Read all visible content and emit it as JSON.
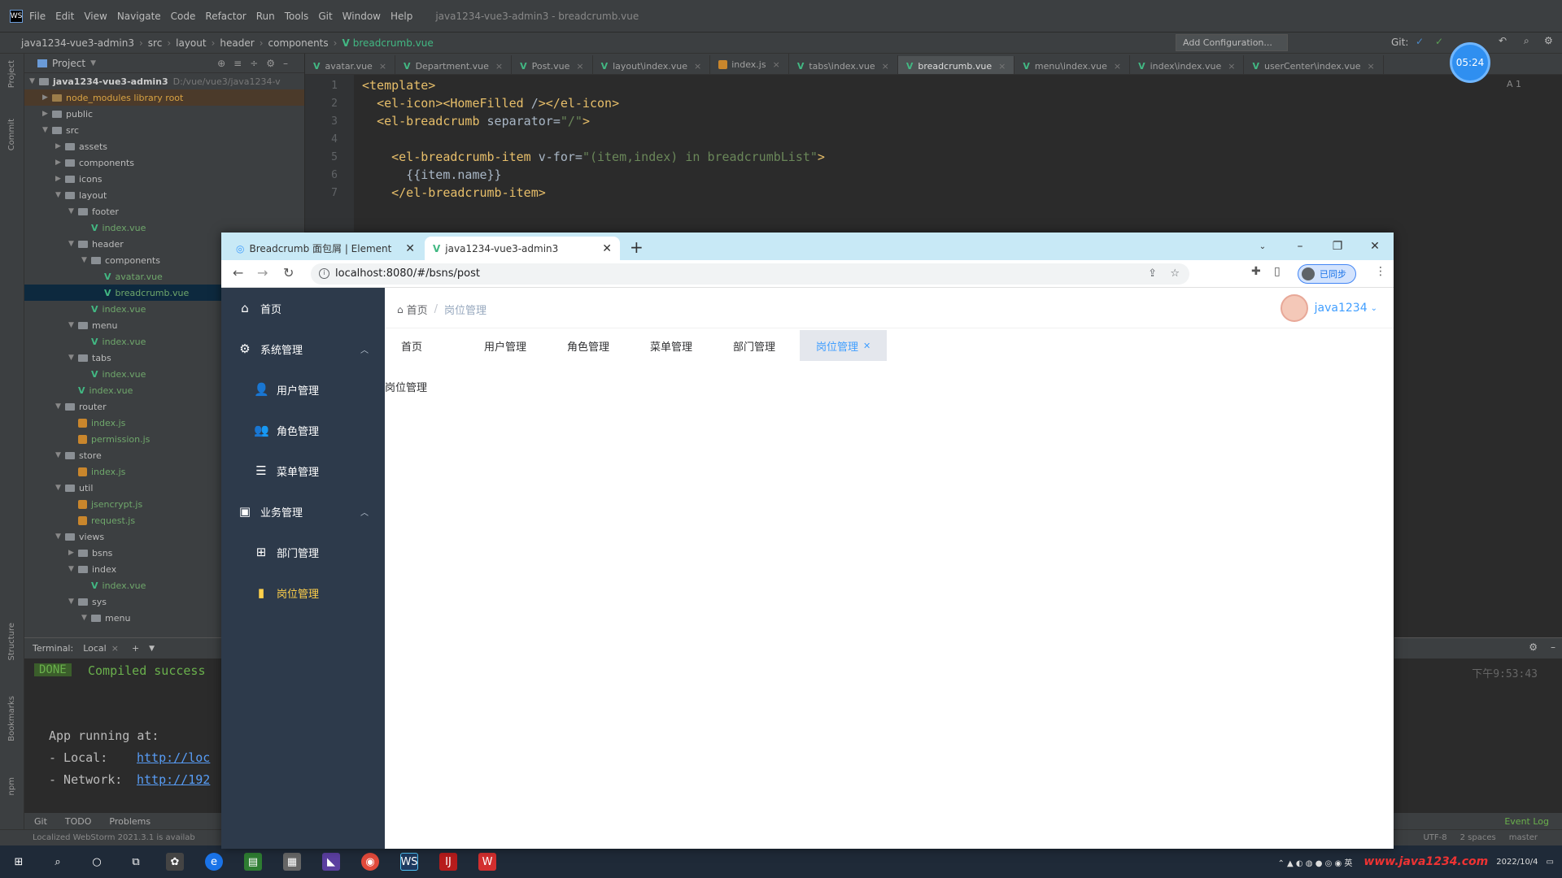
{
  "ide": {
    "menu": [
      "File",
      "Edit",
      "View",
      "Navigate",
      "Code",
      "Refactor",
      "Run",
      "Tools",
      "Git",
      "Window",
      "Help"
    ],
    "window_title": "java1234-vue3-admin3 - breadcrumb.vue",
    "path": [
      "java1234-vue3-admin3",
      "src",
      "layout",
      "header",
      "components"
    ],
    "path_file": "breadcrumb.vue",
    "add_config": "Add Configuration...",
    "git_label": "Git:",
    "side_strip": [
      "Project",
      "Commit",
      "Structure",
      "Bookmarks",
      "npm"
    ],
    "project": {
      "title": "Project",
      "root": "java1234-vue3-admin3",
      "root_path": "D:/vue/vue3/java1234-v",
      "node_modules": "node_modules  library root",
      "items": [
        {
          "label": "public",
          "type": "folder",
          "depth": 1,
          "open": false
        },
        {
          "label": "src",
          "type": "folder",
          "depth": 1,
          "open": true
        },
        {
          "label": "assets",
          "type": "folder",
          "depth": 2,
          "open": false
        },
        {
          "label": "components",
          "type": "folder",
          "depth": 2,
          "open": false
        },
        {
          "label": "icons",
          "type": "folder",
          "depth": 2,
          "open": false
        },
        {
          "label": "layout",
          "type": "folder",
          "depth": 2,
          "open": true
        },
        {
          "label": "footer",
          "type": "folder",
          "depth": 3,
          "open": true
        },
        {
          "label": "index.vue",
          "type": "vue",
          "depth": 4
        },
        {
          "label": "header",
          "type": "folder",
          "depth": 3,
          "open": true
        },
        {
          "label": "components",
          "type": "folder",
          "depth": 4,
          "open": true
        },
        {
          "label": "avatar.vue",
          "type": "vue",
          "depth": 5
        },
        {
          "label": "breadcrumb.vue",
          "type": "vue",
          "depth": 5,
          "selected": true
        },
        {
          "label": "index.vue",
          "type": "vue",
          "depth": 4
        },
        {
          "label": "menu",
          "type": "folder",
          "depth": 3,
          "open": true
        },
        {
          "label": "index.vue",
          "type": "vue",
          "depth": 4
        },
        {
          "label": "tabs",
          "type": "folder",
          "depth": 3,
          "open": true
        },
        {
          "label": "index.vue",
          "type": "vue",
          "depth": 4
        },
        {
          "label": "index.vue",
          "type": "vue",
          "depth": 3
        },
        {
          "label": "router",
          "type": "folder",
          "depth": 2,
          "open": true
        },
        {
          "label": "index.js",
          "type": "js",
          "depth": 3
        },
        {
          "label": "permission.js",
          "type": "js",
          "depth": 3
        },
        {
          "label": "store",
          "type": "folder",
          "depth": 2,
          "open": true
        },
        {
          "label": "index.js",
          "type": "js",
          "depth": 3
        },
        {
          "label": "util",
          "type": "folder",
          "depth": 2,
          "open": true
        },
        {
          "label": "jsencrypt.js",
          "type": "js",
          "depth": 3
        },
        {
          "label": "request.js",
          "type": "js",
          "depth": 3
        },
        {
          "label": "views",
          "type": "folder",
          "depth": 2,
          "open": true
        },
        {
          "label": "bsns",
          "type": "folder",
          "depth": 3,
          "open": false
        },
        {
          "label": "index",
          "type": "folder",
          "depth": 3,
          "open": true
        },
        {
          "label": "index.vue",
          "type": "vue",
          "depth": 4
        },
        {
          "label": "sys",
          "type": "folder",
          "depth": 3,
          "open": true
        },
        {
          "label": "menu",
          "type": "folder",
          "depth": 4,
          "open": true
        }
      ]
    },
    "editor_tabs": [
      {
        "label": "avatar.vue",
        "kind": "vue"
      },
      {
        "label": "Department.vue",
        "kind": "vue"
      },
      {
        "label": "Post.vue",
        "kind": "vue"
      },
      {
        "label": "layout\\index.vue",
        "kind": "vue"
      },
      {
        "label": "index.js",
        "kind": "js"
      },
      {
        "label": "tabs\\index.vue",
        "kind": "vue"
      },
      {
        "label": "breadcrumb.vue",
        "kind": "vue",
        "active": true
      },
      {
        "label": "menu\\index.vue",
        "kind": "vue"
      },
      {
        "label": "index\\index.vue",
        "kind": "vue"
      },
      {
        "label": "userCenter\\index.vue",
        "kind": "vue"
      }
    ],
    "code_lines": [
      {
        "n": "1",
        "t": "<template>"
      },
      {
        "n": "2",
        "t": "  <el-icon><HomeFilled /></el-icon>"
      },
      {
        "n": "3",
        "t": "  <el-breadcrumb separator=\"/\">"
      },
      {
        "n": "4",
        "t": ""
      },
      {
        "n": "5",
        "t": "    <el-breadcrumb-item v-for=\"(item,index) in breadcrumbList\">"
      },
      {
        "n": "6",
        "t": "      {{item.name}}"
      },
      {
        "n": "7",
        "t": "    </el-breadcrumb-item>"
      }
    ],
    "warning_badge": "A 1",
    "recording_timer": "05:24",
    "terminal": {
      "tabs": [
        "Terminal:",
        "Local"
      ],
      "done": "DONE",
      "compiled": "Compiled success",
      "running": "App running at:",
      "local_label": "- Local:",
      "local_url": "http://loc",
      "network_label": "- Network:",
      "network_url": "http://192",
      "timestamp": "下午9:53:43"
    },
    "bottom_tools": [
      "Git",
      "TODO",
      "Problems"
    ],
    "event_log": "Event Log",
    "status_left": "Localized WebStorm 2021.3.1 is availab",
    "status_right": [
      "UTF-8",
      "2 spaces",
      "master"
    ]
  },
  "browser": {
    "tabs": [
      {
        "label": "Breadcrumb 面包屑 | Element",
        "active": false
      },
      {
        "label": "java1234-vue3-admin3",
        "active": true
      }
    ],
    "url": "localhost:8080/#/bsns/post",
    "sync_label": "已同步"
  },
  "app": {
    "menu": [
      {
        "label": "首页",
        "icon": "home-icon",
        "kind": "top"
      },
      {
        "label": "系统管理",
        "icon": "gear-icon",
        "kind": "group",
        "open": true
      },
      {
        "label": "用户管理",
        "icon": "user-icon",
        "kind": "sub"
      },
      {
        "label": "角色管理",
        "icon": "users-icon",
        "kind": "sub"
      },
      {
        "label": "菜单管理",
        "icon": "list-icon",
        "kind": "sub"
      },
      {
        "label": "业务管理",
        "icon": "briefcase-icon",
        "kind": "group",
        "open": true
      },
      {
        "label": "部门管理",
        "icon": "org-icon",
        "kind": "sub"
      },
      {
        "label": "岗位管理",
        "icon": "post-icon",
        "kind": "sub",
        "active": true
      }
    ],
    "breadcrumb": {
      "home": "首页",
      "sep": "/",
      "current": "岗位管理"
    },
    "user_name": "java1234",
    "page_tabs": [
      {
        "label": "首页"
      },
      {
        "label": "用户管理"
      },
      {
        "label": "角色管理"
      },
      {
        "label": "菜单管理"
      },
      {
        "label": "部门管理"
      },
      {
        "label": "岗位管理",
        "active": true
      }
    ],
    "page_content": "岗位管理"
  },
  "taskbar": {
    "date": "2022/10/4",
    "watermark": "www.java1234.com"
  },
  "colors": {
    "sidebar": "#2d3a4b",
    "active_menu": "#ffd04b",
    "link": "#409eff",
    "vue": "#42b883"
  }
}
